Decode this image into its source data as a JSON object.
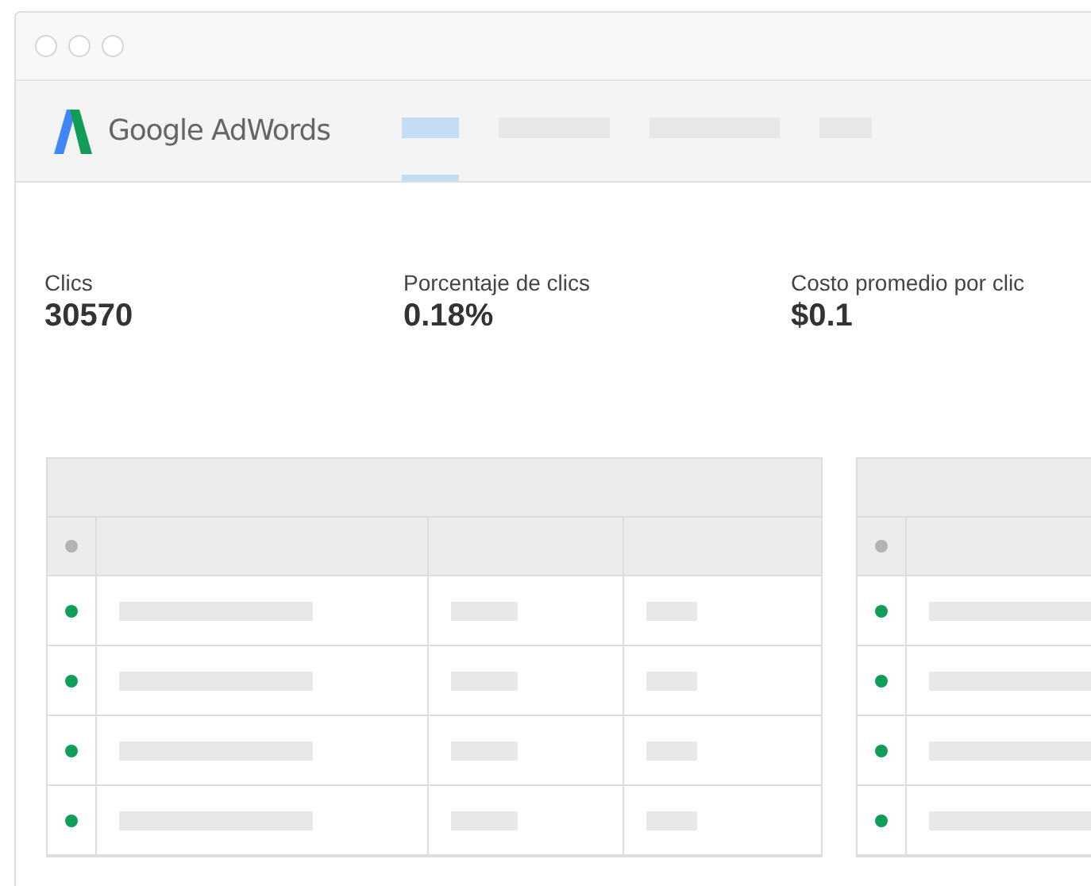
{
  "app": {
    "title": "Google AdWords"
  },
  "nav_tabs": [
    {
      "selected": true
    },
    {
      "selected": false
    },
    {
      "selected": false
    },
    {
      "selected": false
    }
  ],
  "metrics": [
    {
      "label": "Clics",
      "value": "30570"
    },
    {
      "label": "Porcentaje de clics",
      "value": "0.18%"
    },
    {
      "label": "Costo promedio por clic",
      "value": "$0.1"
    }
  ],
  "tables": [
    {
      "header_dot": {
        "color": "#b3b3b3"
      },
      "rows": [
        {
          "color": "#0f9d58"
        },
        {
          "color": "#0f9d58"
        },
        {
          "color": "#0f9d58"
        },
        {
          "color": "#0f9d58"
        }
      ]
    },
    {
      "header_dot": {
        "color": "#b3b3b3"
      },
      "rows": [
        {
          "color": "#0f9d58"
        },
        {
          "color": "#0f9d58"
        },
        {
          "color": "#0f9d58"
        },
        {
          "color": "#0f9d58"
        }
      ]
    }
  ]
}
